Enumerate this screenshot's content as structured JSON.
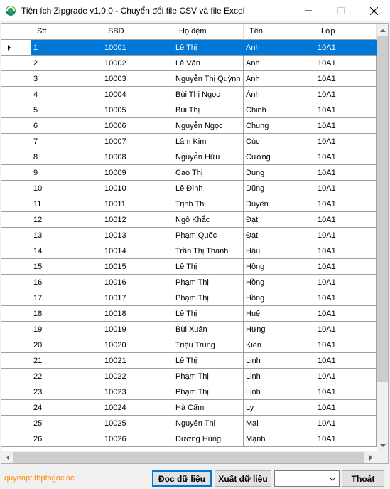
{
  "window": {
    "title": "Tiện ích Zipgrade v1.0.0 - Chuyển đổi file CSV và file Excel",
    "icon": "zipgrade-app-icon",
    "controls": [
      "minimize-icon",
      "maximize-icon",
      "close-icon"
    ]
  },
  "grid": {
    "columns": [
      "Stt",
      "SBD",
      "Họ đệm",
      "Tên",
      "Lớp"
    ],
    "selected_row": 0,
    "rows": [
      [
        "1",
        "10001",
        "Lê Thị",
        "Anh",
        "10A1"
      ],
      [
        "2",
        "10002",
        "Lê Văn",
        "Anh",
        "10A1"
      ],
      [
        "3",
        "10003",
        "Nguyễn Thị Quỳnh",
        "Anh",
        "10A1"
      ],
      [
        "4",
        "10004",
        "Bùi Thị Ngọc",
        "Ánh",
        "10A1"
      ],
      [
        "5",
        "10005",
        "Bùi Thị",
        "Chinh",
        "10A1"
      ],
      [
        "6",
        "10006",
        "Nguyễn Ngọc",
        "Chung",
        "10A1"
      ],
      [
        "7",
        "10007",
        "Lâm Kim",
        "Cúc",
        "10A1"
      ],
      [
        "8",
        "10008",
        "Nguyễn Hữu",
        "Cường",
        "10A1"
      ],
      [
        "9",
        "10009",
        "Cao Thị",
        "Dung",
        "10A1"
      ],
      [
        "10",
        "10010",
        "Lê Đình",
        "Dũng",
        "10A1"
      ],
      [
        "11",
        "10011",
        "Trịnh Thị",
        "Duyên",
        "10A1"
      ],
      [
        "12",
        "10012",
        "Ngô Khắc",
        "Đạt",
        "10A1"
      ],
      [
        "13",
        "10013",
        "Phạm Quốc",
        "Đạt",
        "10A1"
      ],
      [
        "14",
        "10014",
        "Trần Thị Thanh",
        "Hậu",
        "10A1"
      ],
      [
        "15",
        "10015",
        "Lê Thị",
        "Hồng",
        "10A1"
      ],
      [
        "16",
        "10016",
        "Phạm Thị",
        "Hồng",
        "10A1"
      ],
      [
        "17",
        "10017",
        "Phạm Thị",
        "Hồng",
        "10A1"
      ],
      [
        "18",
        "10018",
        "Lê Thị",
        "Huệ",
        "10A1"
      ],
      [
        "19",
        "10019",
        "Bùi Xuân",
        "Hưng",
        "10A1"
      ],
      [
        "20",
        "10020",
        "Triệu Trung",
        "Kiên",
        "10A1"
      ],
      [
        "21",
        "10021",
        "Lê Thị",
        "Linh",
        "10A1"
      ],
      [
        "22",
        "10022",
        "Phạm Thị",
        "Linh",
        "10A1"
      ],
      [
        "23",
        "10023",
        "Phạm Thị",
        "Linh",
        "10A1"
      ],
      [
        "24",
        "10024",
        "Hà Cẩm",
        "Ly",
        "10A1"
      ],
      [
        "25",
        "10025",
        "Nguyễn Thị",
        "Mai",
        "10A1"
      ],
      [
        "26",
        "10026",
        "Dương Hùng",
        "Mạnh",
        "10A1"
      ]
    ]
  },
  "footer": {
    "author_link": "quyenpt.thptngoclac",
    "read_button": "Đọc dữ liệu",
    "export_button": "Xuất dữ liệu",
    "sheet_select_value": "",
    "quit_button": "Thoát"
  },
  "colors": {
    "selection": "#0078d7",
    "link": "#ff8c00",
    "window_bg": "#f0f0f0"
  }
}
